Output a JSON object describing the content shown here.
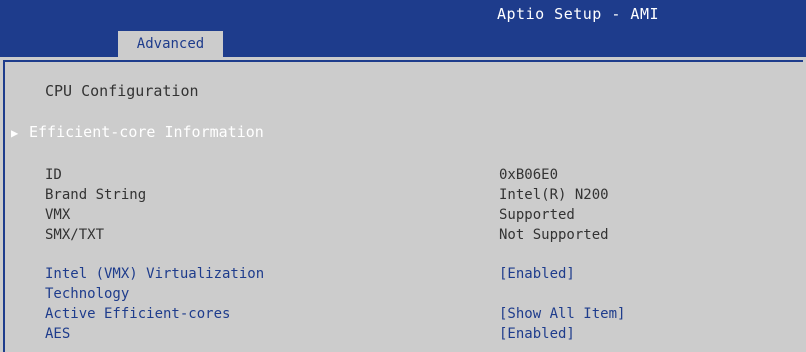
{
  "header": {
    "app_title": "Aptio Setup - AMI",
    "tab_label": "Advanced"
  },
  "main": {
    "section_title": "CPU Configuration",
    "submenu_label": "Efficient-core Information",
    "info_rows": [
      {
        "label": "ID",
        "value": "0xB06E0"
      },
      {
        "label": "Brand String",
        "value": "Intel(R) N200"
      },
      {
        "label": "VMX",
        "value": "Supported"
      },
      {
        "label": "SMX/TXT",
        "value": "Not Supported"
      }
    ],
    "options": [
      {
        "label_line1": "Intel (VMX) Virtualization",
        "label_line2": "Technology",
        "value": "[Enabled]"
      },
      {
        "label": "Active Efficient-cores",
        "value": "[Show All Item]"
      },
      {
        "label": "AES",
        "value": "[Enabled]"
      }
    ]
  },
  "colors": {
    "header_bg": "#1e3c8c",
    "panel_bg": "#cccccc",
    "option_text": "#1e3c8c",
    "selected_text": "#ffffff"
  },
  "icons": {
    "submenu_marker": "triangle-right-icon"
  }
}
